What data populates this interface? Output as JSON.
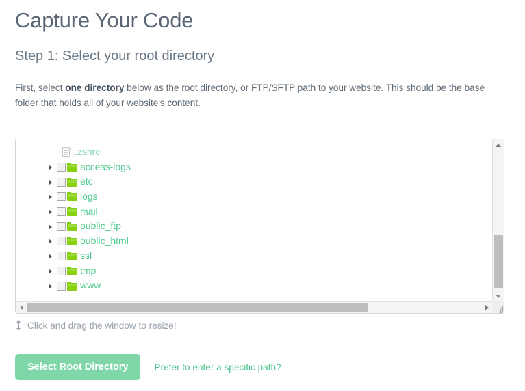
{
  "header": {
    "title": "Capture Your Code",
    "step_title": "Step 1: Select your root directory"
  },
  "intro": {
    "part1": "First, select ",
    "emphasis": "one directory",
    "part2": " below as the root directory, or FTP/SFTP path to your website. This should be the base folder that holds all of your website's content."
  },
  "tree": {
    "nodes": [
      {
        "label": ".zshrc",
        "type": "file",
        "icon": "file-icon",
        "expandable": false,
        "checked": false
      },
      {
        "label": "access-logs",
        "type": "folder",
        "icon": "folder-icon",
        "expandable": true,
        "checked": false
      },
      {
        "label": "etc",
        "type": "folder",
        "icon": "folder-icon",
        "expandable": true,
        "checked": false
      },
      {
        "label": "logs",
        "type": "folder",
        "icon": "folder-icon",
        "expandable": true,
        "checked": false
      },
      {
        "label": "mail",
        "type": "folder",
        "icon": "folder-icon",
        "expandable": true,
        "checked": false
      },
      {
        "label": "public_ftp",
        "type": "folder",
        "icon": "folder-icon",
        "expandable": true,
        "checked": false
      },
      {
        "label": "public_html",
        "type": "folder",
        "icon": "folder-icon",
        "expandable": true,
        "checked": false
      },
      {
        "label": "ssl",
        "type": "folder",
        "icon": "folder-icon",
        "expandable": true,
        "checked": false
      },
      {
        "label": "tmp",
        "type": "folder",
        "icon": "folder-icon",
        "expandable": true,
        "checked": false
      },
      {
        "label": "www",
        "type": "folder",
        "icon": "folder-icon",
        "expandable": true,
        "checked": false
      }
    ]
  },
  "resize_hint": {
    "text": "Click and drag the window to resize!",
    "icon": "resize-vertical-icon"
  },
  "actions": {
    "primary_label": "Select Root Directory",
    "link_label": "Prefer to enter a specific path?"
  },
  "colors": {
    "accent_mint": "#7fd6a8",
    "link_green": "#4cc28c",
    "folder_green": "#86d211",
    "heading_grey": "#5a6673",
    "text_grey": "#5f6b76"
  }
}
